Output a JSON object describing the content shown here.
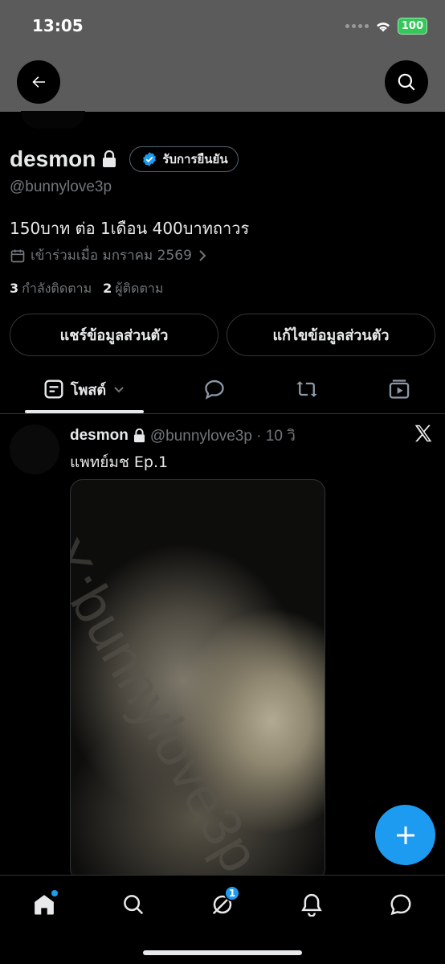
{
  "status_bar": {
    "time": "13:05",
    "battery": "100"
  },
  "profile": {
    "name": "desmon",
    "verify_label": "รับการยืนยัน",
    "handle": "@bunnylove3p",
    "bio": "150บาท ต่อ 1เดือน 400บาทถาวร",
    "joined": "เข้าร่วมเมื่อ มกราคม 2569",
    "following_count": "3",
    "following_label": "กำลังติดตาม",
    "followers_count": "2",
    "followers_label": "ผู้ติดตาม"
  },
  "actions": {
    "share_label": "แชร์ข้อมูลส่วนตัว",
    "edit_label": "แก้ไขข้อมูลส่วนตัว"
  },
  "tabs": {
    "posts_label": "โพสต์"
  },
  "post": {
    "name": "desmon",
    "meta": "@bunnylove3p · 10 วิ",
    "text": "แพทย์มช Ep.1",
    "watermark": "X:bunnylove3p"
  },
  "nav": {
    "messages_badge": "1"
  },
  "colors": {
    "accent": "#1d9bf0",
    "banner": "#5b5b5b",
    "verified": "#1d9bf0"
  },
  "icons": [
    "arrow-left-icon",
    "search-icon",
    "lock-icon",
    "verified-badge-icon",
    "calendar-icon",
    "chevron-right-icon",
    "posts-tab-icon",
    "chevron-down-icon",
    "reply-icon",
    "repost-icon",
    "media-icon",
    "x-logo-icon",
    "plus-icon",
    "home-icon",
    "grok-icon",
    "bell-icon",
    "chat-icon"
  ]
}
